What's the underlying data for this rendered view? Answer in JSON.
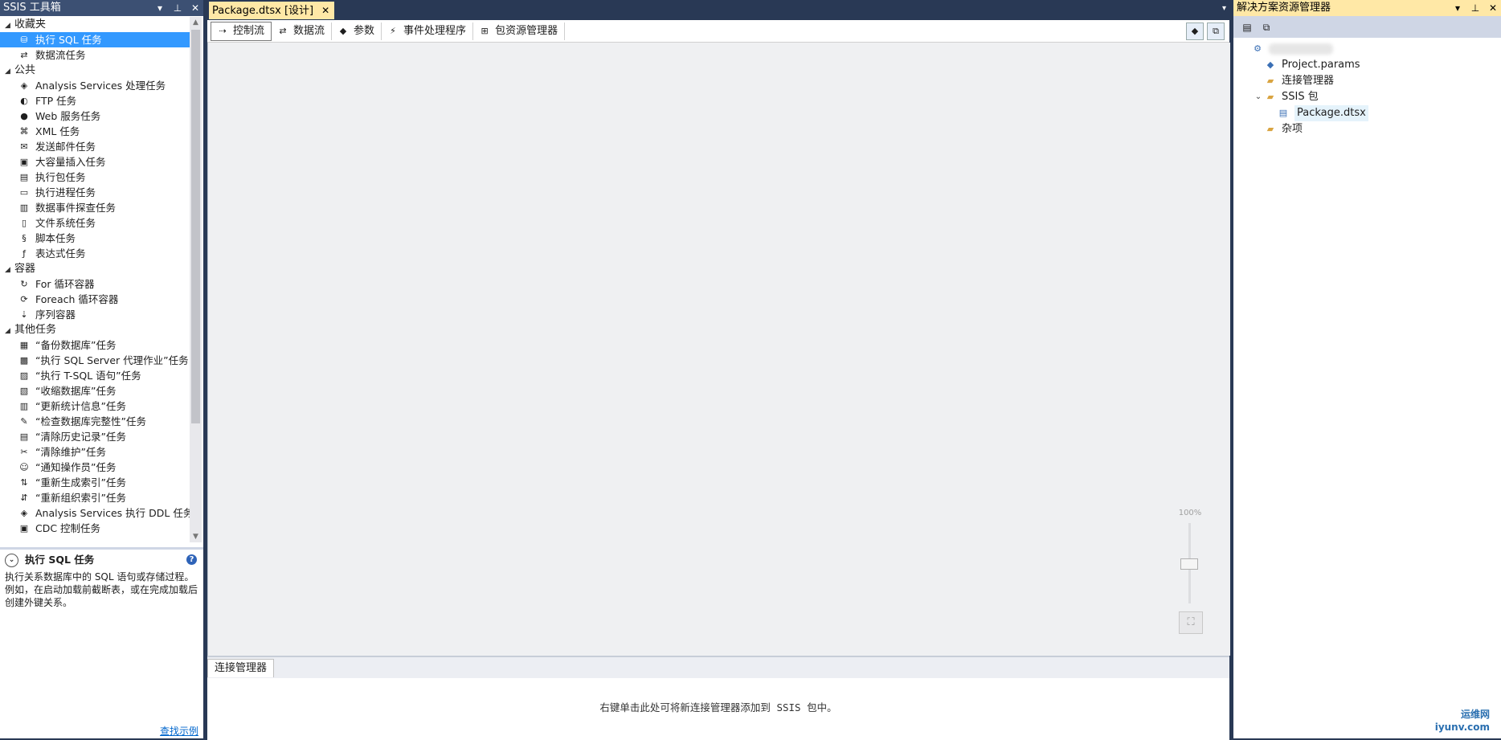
{
  "toolbox": {
    "title": "SSIS 工具箱",
    "groups": [
      {
        "label": "收藏夹",
        "items": [
          {
            "label": "执行 SQL 任务",
            "icon": "sql-task-icon",
            "glyph": "⛁",
            "selected": true
          },
          {
            "label": "数据流任务",
            "icon": "data-flow-icon",
            "glyph": "⇄"
          }
        ]
      },
      {
        "label": "公共",
        "items": [
          {
            "label": "Analysis Services 处理任务",
            "icon": "cube-icon",
            "glyph": "◈"
          },
          {
            "label": "FTP 任务",
            "icon": "ftp-globe-icon",
            "glyph": "◐"
          },
          {
            "label": "Web 服务任务",
            "icon": "globe-icon",
            "glyph": "●"
          },
          {
            "label": "XML 任务",
            "icon": "xml-icon",
            "glyph": "⌘"
          },
          {
            "label": "发送邮件任务",
            "icon": "mail-icon",
            "glyph": "✉"
          },
          {
            "label": "大容量插入任务",
            "icon": "bulk-insert-icon",
            "glyph": "▣"
          },
          {
            "label": "执行包任务",
            "icon": "package-icon",
            "glyph": "▤"
          },
          {
            "label": "执行进程任务",
            "icon": "process-icon",
            "glyph": "▭"
          },
          {
            "label": "数据事件探查任务",
            "icon": "profiler-icon",
            "glyph": "▥"
          },
          {
            "label": "文件系统任务",
            "icon": "file-icon",
            "glyph": "▯"
          },
          {
            "label": "脚本任务",
            "icon": "script-icon",
            "glyph": "§"
          },
          {
            "label": "表达式任务",
            "icon": "fx-icon",
            "glyph": "ƒ"
          }
        ]
      },
      {
        "label": "容器",
        "items": [
          {
            "label": "For 循环容器",
            "icon": "for-loop-icon",
            "glyph": "↻"
          },
          {
            "label": "Foreach 循环容器",
            "icon": "foreach-loop-icon",
            "glyph": "⟳"
          },
          {
            "label": "序列容器",
            "icon": "sequence-icon",
            "glyph": "⇣"
          }
        ]
      },
      {
        "label": "其他任务",
        "items": [
          {
            "label": "“备份数据库”任务",
            "icon": "backup-icon",
            "glyph": "▦"
          },
          {
            "label": "“执行 SQL Server 代理作业”任务",
            "icon": "agent-job-icon",
            "glyph": "▩"
          },
          {
            "label": "“执行 T-SQL 语句”任务",
            "icon": "tsql-icon",
            "glyph": "▨"
          },
          {
            "label": "“收缩数据库”任务",
            "icon": "shrink-icon",
            "glyph": "▧"
          },
          {
            "label": "“更新统计信息”任务",
            "icon": "stats-icon",
            "glyph": "▥"
          },
          {
            "label": "“检查数据库完整性”任务",
            "icon": "integrity-icon",
            "glyph": "✎"
          },
          {
            "label": "“清除历史记录”任务",
            "icon": "history-icon",
            "glyph": "▤"
          },
          {
            "label": "“清除维护”任务",
            "icon": "cleanup-icon",
            "glyph": "✂"
          },
          {
            "label": "“通知操作员”任务",
            "icon": "operator-icon",
            "glyph": "☺"
          },
          {
            "label": "“重新生成索引”任务",
            "icon": "rebuild-index-icon",
            "glyph": "⇅"
          },
          {
            "label": "“重新组织索引”任务",
            "icon": "reorganize-index-icon",
            "glyph": "⇵"
          },
          {
            "label": "Analysis Services 执行 DDL 任务",
            "icon": "ddl-icon",
            "glyph": "◈"
          },
          {
            "label": "CDC 控制任务",
            "icon": "cdc-icon",
            "glyph": "▣"
          }
        ]
      }
    ],
    "description": {
      "title": "执行 SQL 任务",
      "text": "执行关系数据库中的 SQL 语句或存储过程。例如，在启动加载前截断表，或在完成加载后创建外键关系。",
      "link": "查找示例"
    }
  },
  "document": {
    "tab_label": "Package.dtsx [设计]",
    "designer_tabs": [
      {
        "label": "控制流",
        "icon": "control-flow-icon",
        "glyph": "⇢",
        "active": true
      },
      {
        "label": "数据流",
        "icon": "data-flow-tab-icon",
        "glyph": "⇄"
      },
      {
        "label": "参数",
        "icon": "parameter-icon",
        "glyph": "◆"
      },
      {
        "label": "事件处理程序",
        "icon": "event-handler-icon",
        "glyph": "⚡"
      },
      {
        "label": "包资源管理器",
        "icon": "package-explorer-icon",
        "glyph": "⊞"
      }
    ],
    "zoom": "100%",
    "connection_managers": {
      "tab_label": "连接管理器",
      "hint": "右键单击此处可将新连接管理器添加到 SSIS 包中。"
    }
  },
  "solution_explorer": {
    "title": "解决方案资源管理器",
    "tree": [
      {
        "label": "",
        "icon": "project-icon",
        "glyph": "⚙",
        "level": 0,
        "blurred": true
      },
      {
        "label": "Project.params",
        "icon": "params-icon",
        "glyph": "◆",
        "level": 1
      },
      {
        "label": "连接管理器",
        "icon": "folder-icon",
        "glyph": "▰",
        "level": 1
      },
      {
        "label": "SSIS 包",
        "icon": "folder-open-icon",
        "glyph": "▰",
        "level": 1,
        "expanded": true
      },
      {
        "label": "Package.dtsx",
        "icon": "dtsx-file-icon",
        "glyph": "▤",
        "level": 2,
        "selected": true
      },
      {
        "label": "杂项",
        "icon": "folder-icon",
        "glyph": "▰",
        "level": 1
      }
    ]
  },
  "watermark": {
    "line1": "运维网",
    "line2": "iyunv.com"
  },
  "colors": {
    "title_inactive": "#3c5073",
    "title_active": "#ffe8a6",
    "selection": "#3399ff",
    "background": "#293955"
  }
}
